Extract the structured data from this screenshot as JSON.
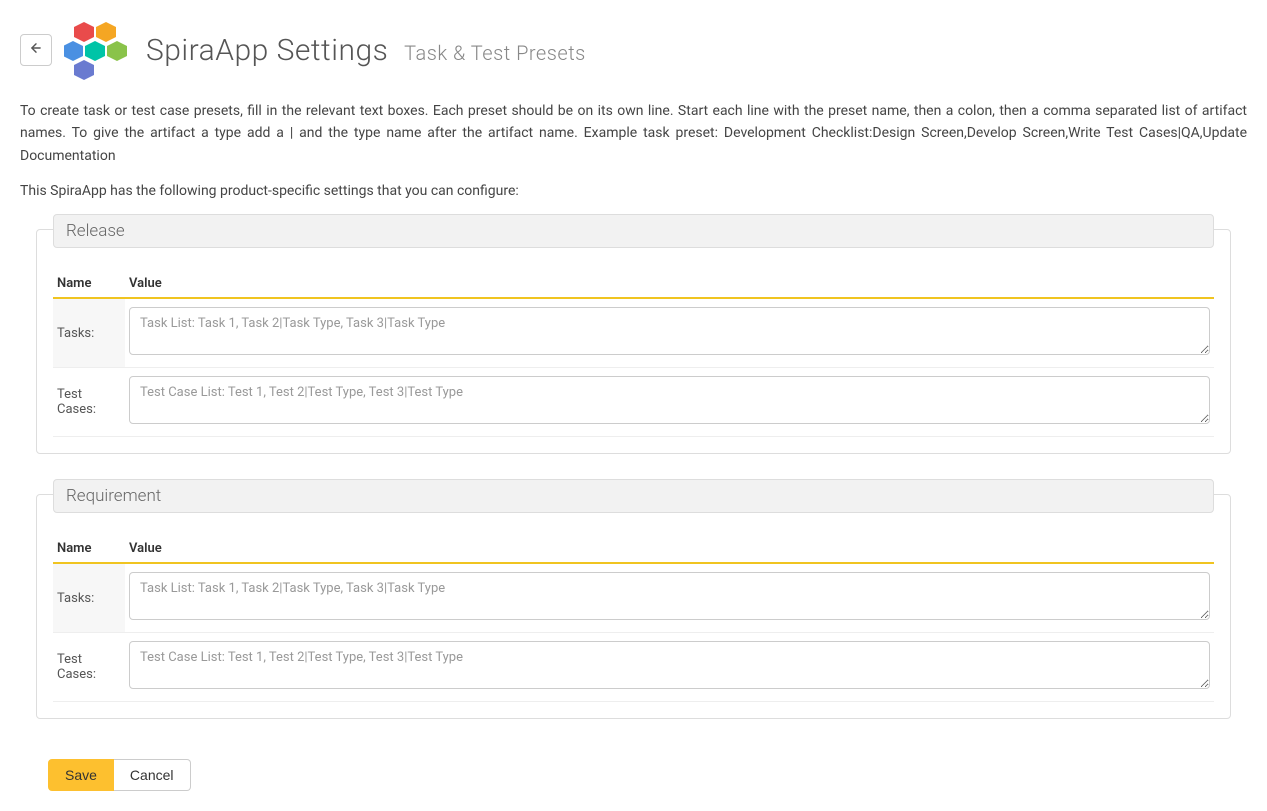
{
  "header": {
    "title": "SpiraApp Settings",
    "subtitle": "Task & Test Presets"
  },
  "description": "To create task or test case presets, fill in the relevant text boxes. Each preset should be on its own line. Start each line with the preset name, then a colon, then a comma separated list of artifact names. To give the artifact a type add a | and the type name after the artifact name. Example task preset: Development Checklist:Design Screen,Develop Screen,Write Test Cases|QA,Update Documentation",
  "subdescription": "This SpiraApp has the following product-specific settings that you can configure:",
  "columns": {
    "name": "Name",
    "value": "Value"
  },
  "sections": [
    {
      "legend": "Release",
      "rows": [
        {
          "label": "Tasks:",
          "placeholder": "Task List: Task 1, Task 2|Task Type, Task 3|Task Type",
          "value": ""
        },
        {
          "label": "Test Cases:",
          "placeholder": "Test Case List: Test 1, Test 2|Test Type, Test 3|Test Type",
          "value": ""
        }
      ]
    },
    {
      "legend": "Requirement",
      "rows": [
        {
          "label": "Tasks:",
          "placeholder": "Task List: Task 1, Task 2|Task Type, Task 3|Task Type",
          "value": ""
        },
        {
          "label": "Test Cases:",
          "placeholder": "Test Case List: Test 1, Test 2|Test Type, Test 3|Test Type",
          "value": ""
        }
      ]
    }
  ],
  "buttons": {
    "save": "Save",
    "cancel": "Cancel"
  },
  "logo_colors": {
    "top_left": "#e94b4b",
    "top_right": "#f5a623",
    "mid_left": "#4a90e2",
    "center": "#00c4a7",
    "mid_right": "#8ac34a",
    "bottom": "#6a7bd0"
  }
}
